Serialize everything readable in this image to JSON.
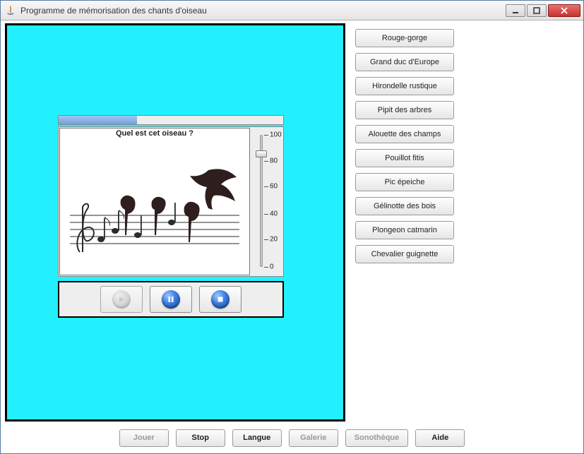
{
  "window": {
    "title": "Programme de mémorisation des chants d'oiseau"
  },
  "quiz": {
    "question": "Quel est cet oiseau ?",
    "progress_percent": 35,
    "volume": {
      "min": 0,
      "max": 100,
      "step": 20,
      "value": 84,
      "ticks": [
        100,
        80,
        60,
        40,
        20,
        0
      ]
    }
  },
  "birds": [
    "Rouge-gorge",
    "Grand duc d'Europe",
    "Hirondelle rustique",
    "Pipit des arbres",
    "Alouette des champs",
    "Pouillot fitis",
    "Pic épeiche",
    "Gélinotte des bois",
    "Plongeon catmarin",
    "Chevalier guignette"
  ],
  "media_controls": {
    "play_enabled": false,
    "pause_enabled": true,
    "stop_enabled": true
  },
  "bottom_buttons": [
    {
      "label": "Jouer",
      "enabled": false
    },
    {
      "label": "Stop",
      "enabled": true
    },
    {
      "label": "Langue",
      "enabled": true
    },
    {
      "label": "Galerie",
      "enabled": false
    },
    {
      "label": "Sonothèque",
      "enabled": false
    },
    {
      "label": "Aide",
      "enabled": true
    }
  ]
}
